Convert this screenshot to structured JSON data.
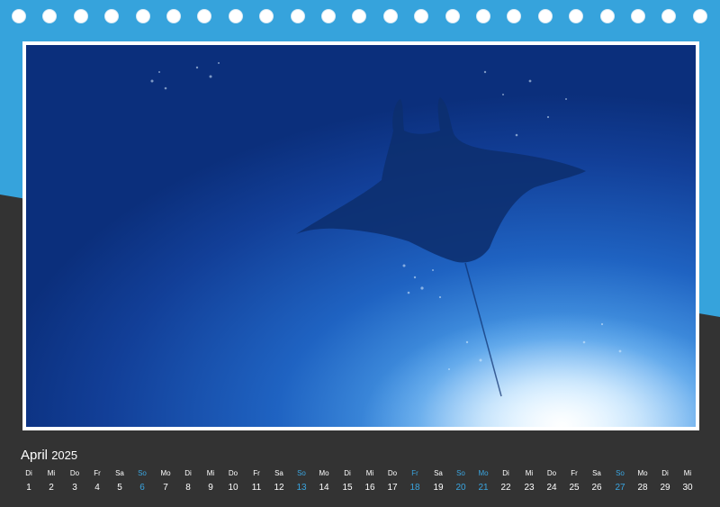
{
  "calendar": {
    "month": "April",
    "year": "2025",
    "highlight_color": "#3aa5e0",
    "days": [
      {
        "name": "Di",
        "num": "1",
        "hl": false
      },
      {
        "name": "Mi",
        "num": "2",
        "hl": false
      },
      {
        "name": "Do",
        "num": "3",
        "hl": false
      },
      {
        "name": "Fr",
        "num": "4",
        "hl": false
      },
      {
        "name": "Sa",
        "num": "5",
        "hl": false
      },
      {
        "name": "So",
        "num": "6",
        "hl": true
      },
      {
        "name": "Mo",
        "num": "7",
        "hl": false
      },
      {
        "name": "Di",
        "num": "8",
        "hl": false
      },
      {
        "name": "Mi",
        "num": "9",
        "hl": false
      },
      {
        "name": "Do",
        "num": "10",
        "hl": false
      },
      {
        "name": "Fr",
        "num": "11",
        "hl": false
      },
      {
        "name": "Sa",
        "num": "12",
        "hl": false
      },
      {
        "name": "So",
        "num": "13",
        "hl": true
      },
      {
        "name": "Mo",
        "num": "14",
        "hl": false
      },
      {
        "name": "Di",
        "num": "15",
        "hl": false
      },
      {
        "name": "Mi",
        "num": "16",
        "hl": false
      },
      {
        "name": "Do",
        "num": "17",
        "hl": false
      },
      {
        "name": "Fr",
        "num": "18",
        "hl": true
      },
      {
        "name": "Sa",
        "num": "19",
        "hl": false
      },
      {
        "name": "So",
        "num": "20",
        "hl": true
      },
      {
        "name": "Mo",
        "num": "21",
        "hl": true
      },
      {
        "name": "Di",
        "num": "22",
        "hl": false
      },
      {
        "name": "Mi",
        "num": "23",
        "hl": false
      },
      {
        "name": "Do",
        "num": "24",
        "hl": false
      },
      {
        "name": "Fr",
        "num": "25",
        "hl": false
      },
      {
        "name": "Sa",
        "num": "26",
        "hl": false
      },
      {
        "name": "So",
        "num": "27",
        "hl": true
      },
      {
        "name": "Mo",
        "num": "28",
        "hl": false
      },
      {
        "name": "Di",
        "num": "29",
        "hl": false
      },
      {
        "name": "Mi",
        "num": "30",
        "hl": false
      }
    ]
  },
  "colors": {
    "top_band": "#36a3dc",
    "bottom_band": "#333333",
    "photo_deep": "#0d3a8a",
    "photo_light": "#cfeaff"
  },
  "photo": {
    "subject": "manta-ray-silhouette"
  }
}
